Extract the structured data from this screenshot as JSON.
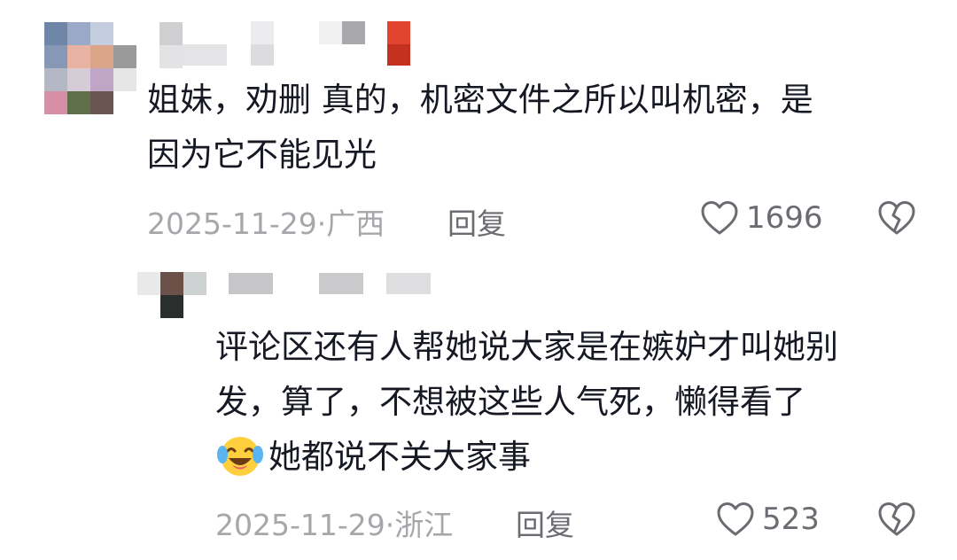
{
  "comments": [
    {
      "text_lines": [
        "姐妹，劝删 真的，机密文件之所以叫机密，是",
        "因为它不能见光"
      ],
      "date": "2025-11-29",
      "location": "广西",
      "reply_label": "回复",
      "likes": "1696",
      "icons": {
        "like": "heart-outline-icon",
        "dislike": "broken-heart-icon"
      },
      "replies": [
        {
          "text_lines": [
            "评论区还有人帮她说大家是在嫉妒才叫她别",
            "发，算了，不想被这些人气死，懒得看了"
          ],
          "emoji": "crying-laughing-emoji",
          "text_line3": "她都说不关大家事",
          "date": "2025-11-29",
          "location": "浙江",
          "reply_label": "回复",
          "likes": "523"
        }
      ]
    }
  ],
  "colors": {
    "text": "#161823",
    "meta": "#a6a6ab",
    "action": "#6b6c72",
    "background": "#ffffff"
  }
}
